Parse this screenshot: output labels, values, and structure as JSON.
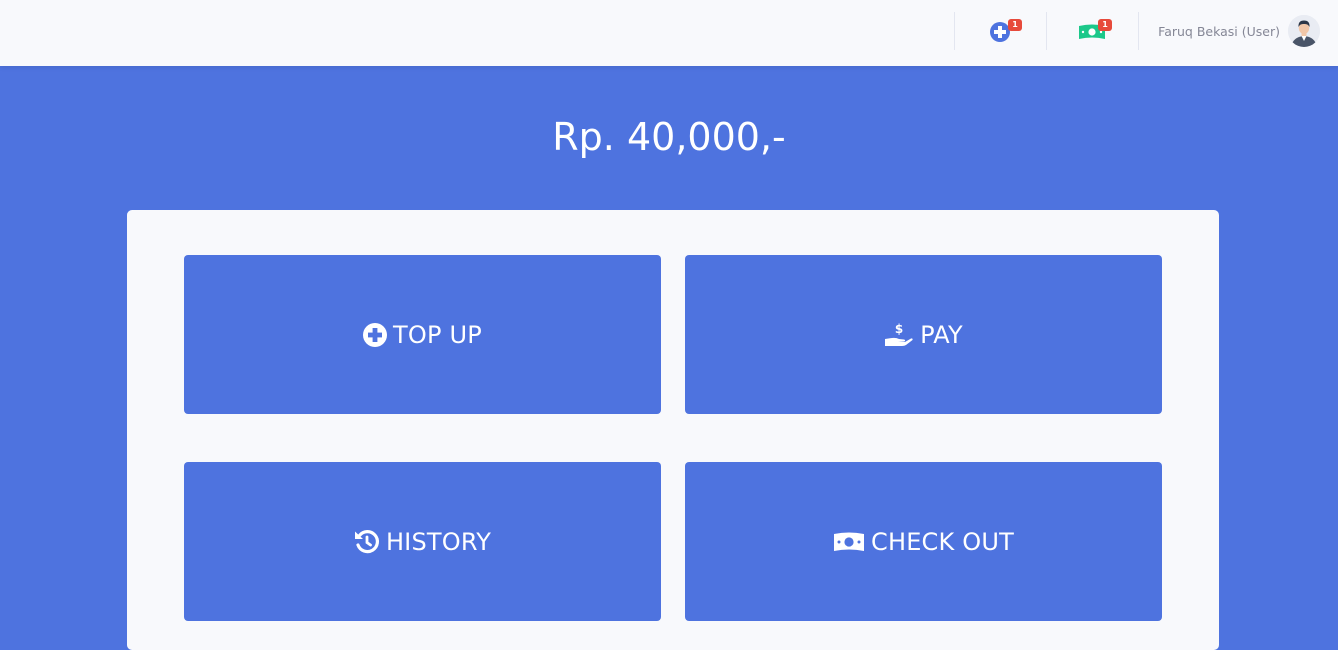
{
  "topbar": {
    "topup_alerts": {
      "icon": "plus-circle-icon",
      "badge": "1"
    },
    "cash_alerts": {
      "icon": "money-bill-icon",
      "badge": "1"
    },
    "user": {
      "name": "Faruq Bekasi (User)",
      "avatar": "user-avatar"
    }
  },
  "wallet": {
    "balance": "Rp. 40,000,-"
  },
  "actions": [
    {
      "label": "TOP UP",
      "icon": "plus-circle-icon"
    },
    {
      "label": "PAY",
      "icon": "hand-holding-usd-icon"
    },
    {
      "label": "HISTORY",
      "icon": "history-icon"
    },
    {
      "label": "CHECK OUT",
      "icon": "money-bill-icon"
    }
  ],
  "colors": {
    "primary": "#4e73df",
    "light": "#f8f9fc",
    "danger": "#e74a3b",
    "success": "#1cc88a",
    "muted": "#858796"
  }
}
